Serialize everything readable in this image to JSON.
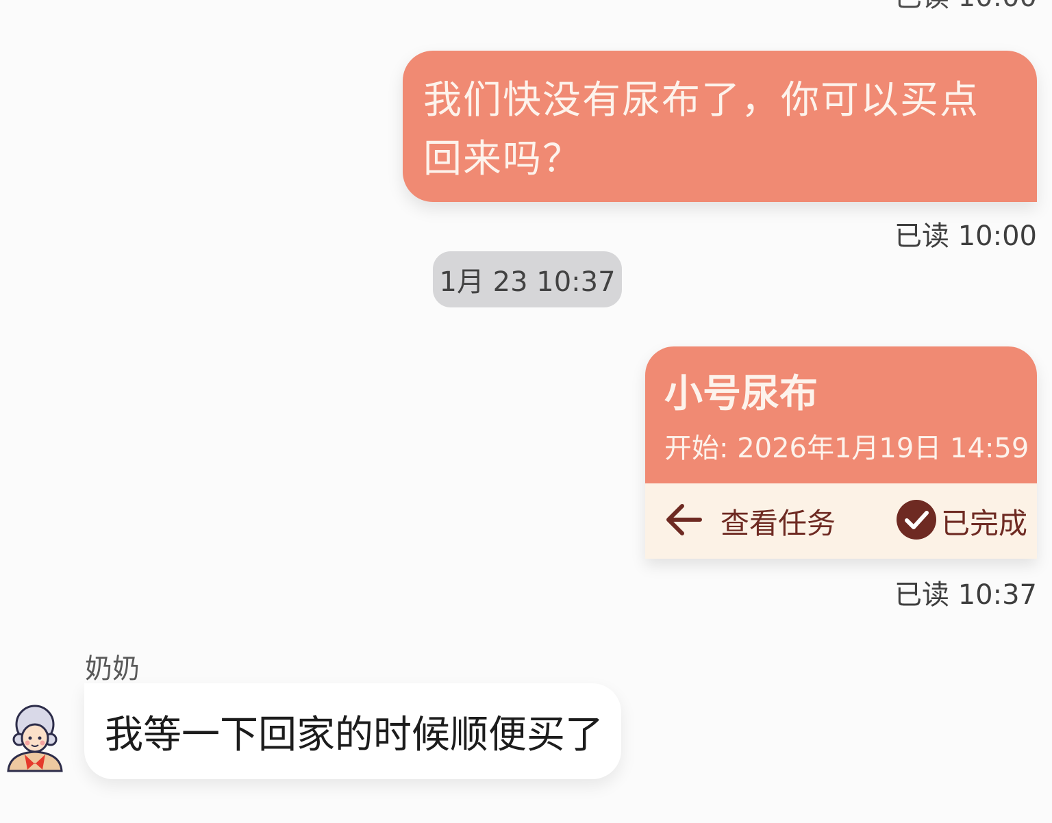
{
  "colors": {
    "outgoing_bubble": "#f08a73",
    "outgoing_text": "#fdf3ec",
    "card_footer": "#fcf2e6",
    "card_action": "#6e2a22",
    "date_pill": "#d6d6d8",
    "incoming_bubble": "#ffffff",
    "background": "#fbfbfb"
  },
  "top_meta": "已读 10:00",
  "messages": {
    "outgoing_1": {
      "text": "我们快没有尿布了，你可以买点回来吗？",
      "status": "已读 10:00"
    },
    "date_divider": "1月 23 10:37",
    "task_card": {
      "title": "小号尿布",
      "start": "开始: 2026年1月19日 14:59",
      "view_action": "查看任务",
      "done_label": "已完成",
      "status": "已读 10:37",
      "icons": [
        "arrow-left-icon",
        "check-circle-icon"
      ]
    },
    "incoming_1": {
      "sender": "奶奶",
      "text": "我等一下回家的时候顺便买了",
      "avatar_icon": "grandma-avatar-icon"
    }
  }
}
